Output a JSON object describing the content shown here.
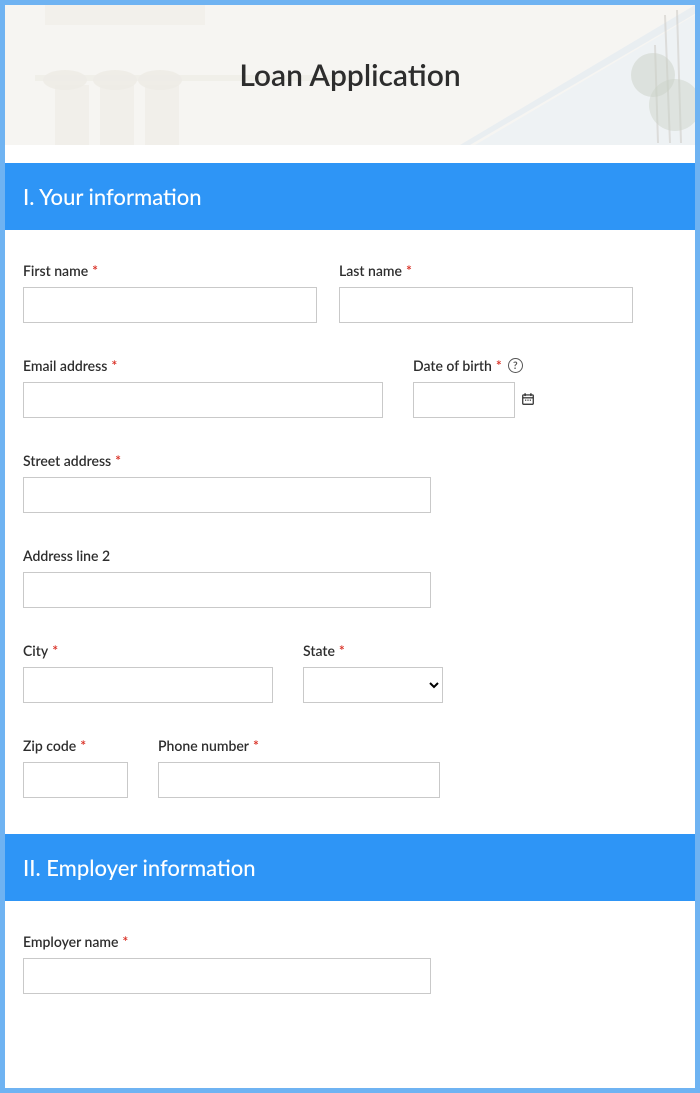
{
  "header": {
    "title": "Loan Application"
  },
  "section1": {
    "title": "I. Your information",
    "fields": {
      "first_name": {
        "label": "First name"
      },
      "last_name": {
        "label": "Last name"
      },
      "email": {
        "label": "Email address"
      },
      "dob": {
        "label": "Date of birth"
      },
      "street": {
        "label": "Street address"
      },
      "address2": {
        "label": "Address line 2"
      },
      "city": {
        "label": "City"
      },
      "state": {
        "label": "State"
      },
      "zip": {
        "label": "Zip code"
      },
      "phone": {
        "label": "Phone number"
      }
    }
  },
  "section2": {
    "title": "II. Employer information",
    "fields": {
      "employer_name": {
        "label": "Employer name"
      }
    }
  },
  "required_marker": "*",
  "help_text": "?"
}
